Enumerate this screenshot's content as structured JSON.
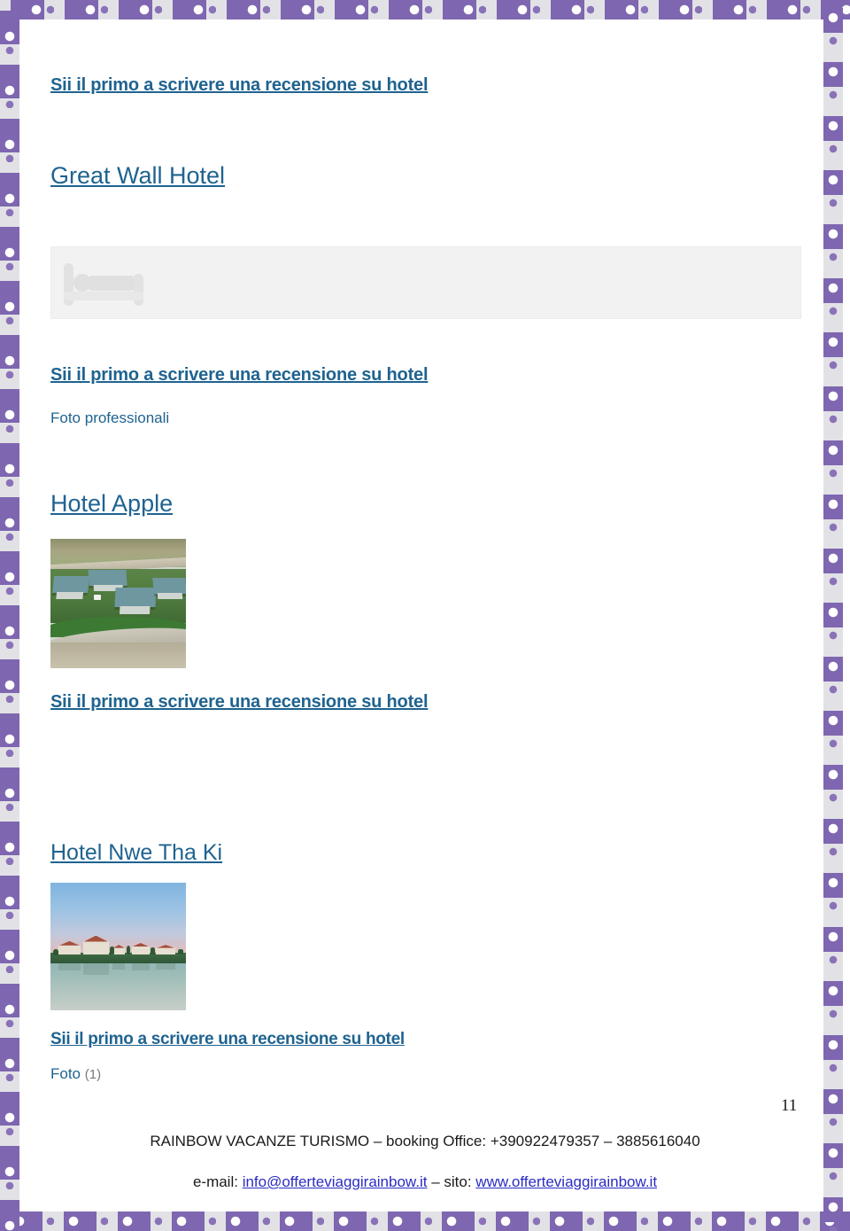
{
  "page": {
    "page_number": "11",
    "border_colors": {
      "band": "#e2e2e6",
      "block": "#7e66b0",
      "dot": "#8a72b8",
      "inner_dot": "#ffffff"
    },
    "link_color": "#1f6390",
    "hyperlink_color": "#2b2bc4"
  },
  "entries": [
    {
      "review_link": "Sii il primo a scrivere una recensione su hotel",
      "hotel_name": "Great Wall Hotel",
      "image": "hotel-placeholder-bed-icon",
      "caption": null,
      "caption_count": null
    },
    {
      "review_link": "Sii il primo a scrivere una recensione su hotel",
      "caption": "Foto professionali",
      "caption_count": null,
      "hotel_name": "Hotel Apple",
      "image": "aerial-resort-bungalows-photo"
    },
    {
      "review_link": "Sii il primo a scrivere una recensione su hotel",
      "hotel_name": "Hotel Nwe Tha Ki",
      "image": "lakeside-hotel-reflection-photo",
      "caption": null,
      "caption_count": null
    },
    {
      "review_link": "Sii il primo a scrivere una recensione su hotel",
      "caption": "Foto",
      "caption_count": "(1)",
      "hotel_name": null,
      "image": null
    }
  ],
  "footer": {
    "company_line": "RAINBOW VACANZE TURISMO – booking Office: +390922479357 – 3885616040",
    "contact_prefix": "e-mail: ",
    "email": "info@offerteviaggirainbow.it",
    "contact_separator": " – sito: ",
    "website": "www.offerteviaggirainbow.it"
  }
}
